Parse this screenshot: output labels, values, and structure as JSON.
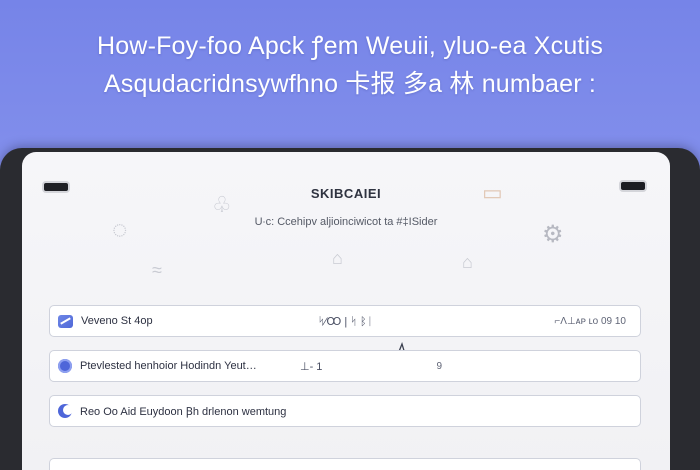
{
  "headline": {
    "line1": "How-Foy-foo Apck  ꝭem Weuii, yluo-ea Xcutis",
    "line2": "Asqudacridnsywfhno 卡报 多a 林 numbaer :"
  },
  "app": {
    "title": "SKIBCAIEI",
    "subtitle": "U∙c: Ccehipv aljioinciwicot ta  #‡ISider"
  },
  "rows": [
    {
      "icon": "flag-icon",
      "label": "Vevenо St 4ор",
      "mid": "ᛋ⁄Ꝏ  | ᛋ ᛒᛁ",
      "right": "⌐Ʌ⊥ᴀᴘ ʟo 09 10"
    },
    {
      "icon": "radio-dot-icon",
      "label": "Ptevlested  henhoior Hodindn Yeut…",
      "mid": "⊥- 1",
      "right": "9"
    },
    {
      "icon": "moon-icon",
      "label": "Reo Oo Aid Euydoon Ꞵh drlenon wemtung",
      "mid": "",
      "right": ""
    }
  ],
  "colors": {
    "background": "#7a87e9",
    "accent": "#4e66d9",
    "device": "#2a2b30"
  }
}
